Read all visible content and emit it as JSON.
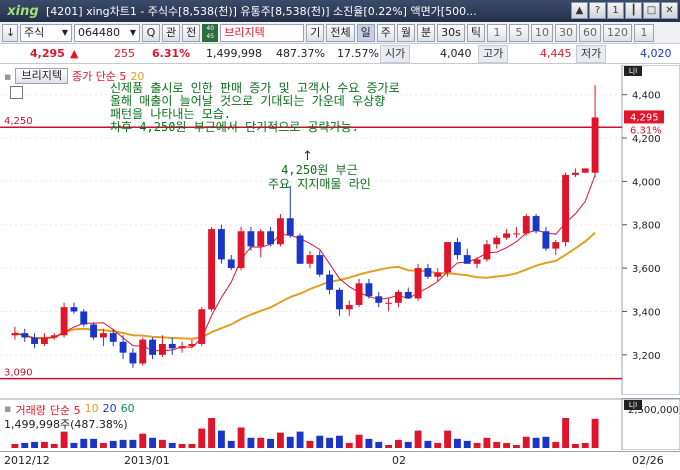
{
  "window": {
    "logo": "xing",
    "title": "[4201] xing차트1 - 주식수[8,538(천)] 유통주[8,538(천)] 소진율[0.22%] 액면가[500...",
    "buttons": [
      "▲",
      "?",
      "1",
      "┃",
      "□",
      "✕"
    ]
  },
  "toolbar": {
    "arrow": "↓",
    "market": "주식",
    "code": "064480",
    "search_label": "Q",
    "buttons_a": [
      "관",
      "전"
    ],
    "badge": "40\n45",
    "name": "브리지텍",
    "period_label": "기",
    "all_label": "전체",
    "periods": [
      "일",
      "주",
      "월",
      "분",
      "30s",
      "틱"
    ],
    "intervals": [
      "1",
      "5",
      "10",
      "30",
      "60",
      "120",
      "1"
    ]
  },
  "quote": {
    "price": "4,295",
    "change_arrow": "▲",
    "change": "255",
    "change_pct": "6.31%",
    "volume": "1,499,998",
    "vol_ratio": "487.37%",
    "turnover": "17.57%",
    "open_label": "시가",
    "open": "4,040",
    "high_label": "고가",
    "high": "4,445",
    "low_label": "저가",
    "low": "4,020"
  },
  "legend": {
    "indicator_button": "브리지텍",
    "ma_label": "종가 단순 5",
    "ma_period2": "20"
  },
  "annotation": {
    "main": "신제품 출시로 인한 판매 증가 및 고객사 수요 증가로\n올해 매출이 늘어날 것으로 기대되는 가운데 우상향\n패턴을 나타내는 모습.\n차후 4,250원 부근에서 단기적으로 공략가능.",
    "arrow": "↑",
    "support": "4,250원 부근\n주요 지지매물 라인"
  },
  "levels": {
    "upper_label": "4,250",
    "lower_label": "3,090",
    "current_price_tag": "4,295",
    "current_pct_tag": "6.31%"
  },
  "axis": {
    "price_ticks": [
      "4,400",
      "4,200",
      "4,000",
      "3,800",
      "3,600",
      "3,400",
      "3,200"
    ],
    "vol_tick": "2,500,000",
    "dates": [
      "2012/12",
      "2013/01",
      "02",
      "02/26"
    ]
  },
  "volume_panel": {
    "legend_label": "거래량",
    "ma_label": "단순 5",
    "periods": [
      "10",
      "20",
      "60"
    ],
    "value": "1,499,998주(487.38%)"
  },
  "colors": {
    "up": "#e0142a",
    "down": "#1a36c8",
    "ma5": "#e0142a",
    "ma20": "#e0a020",
    "annotation": "#0a6e1a"
  },
  "chart_data": {
    "type": "candlestick",
    "ylim": [
      3090,
      4500
    ],
    "candles": [
      [
        3290,
        3330,
        3270,
        3300
      ],
      [
        3300,
        3320,
        3260,
        3280
      ],
      [
        3280,
        3300,
        3230,
        3250
      ],
      [
        3250,
        3300,
        3240,
        3280
      ],
      [
        3280,
        3300,
        3270,
        3290
      ],
      [
        3290,
        3440,
        3280,
        3420
      ],
      [
        3420,
        3440,
        3390,
        3400
      ],
      [
        3400,
        3410,
        3330,
        3340
      ],
      [
        3340,
        3350,
        3270,
        3280
      ],
      [
        3280,
        3320,
        3240,
        3300
      ],
      [
        3300,
        3320,
        3240,
        3260
      ],
      [
        3260,
        3290,
        3180,
        3210
      ],
      [
        3210,
        3230,
        3140,
        3160
      ],
      [
        3160,
        3280,
        3150,
        3270
      ],
      [
        3270,
        3280,
        3180,
        3200
      ],
      [
        3200,
        3290,
        3190,
        3250
      ],
      [
        3250,
        3280,
        3200,
        3230
      ],
      [
        3230,
        3260,
        3210,
        3240
      ],
      [
        3240,
        3270,
        3230,
        3250
      ],
      [
        3250,
        3420,
        3240,
        3410
      ],
      [
        3410,
        3790,
        3400,
        3780
      ],
      [
        3780,
        3800,
        3620,
        3640
      ],
      [
        3640,
        3660,
        3590,
        3600
      ],
      [
        3600,
        3790,
        3590,
        3770
      ],
      [
        3770,
        3790,
        3680,
        3700
      ],
      [
        3700,
        3780,
        3650,
        3770
      ],
      [
        3770,
        3790,
        3700,
        3710
      ],
      [
        3710,
        3850,
        3700,
        3830
      ],
      [
        3830,
        3980,
        3740,
        3750
      ],
      [
        3750,
        3760,
        3620,
        3620
      ],
      [
        3620,
        3680,
        3600,
        3660
      ],
      [
        3660,
        3680,
        3560,
        3570
      ],
      [
        3570,
        3590,
        3480,
        3500
      ],
      [
        3500,
        3510,
        3380,
        3410
      ],
      [
        3410,
        3450,
        3380,
        3430
      ],
      [
        3430,
        3550,
        3420,
        3530
      ],
      [
        3530,
        3550,
        3460,
        3470
      ],
      [
        3470,
        3490,
        3420,
        3440
      ],
      [
        3440,
        3460,
        3400,
        3440
      ],
      [
        3440,
        3500,
        3420,
        3490
      ],
      [
        3490,
        3510,
        3460,
        3460
      ],
      [
        3460,
        3620,
        3450,
        3600
      ],
      [
        3600,
        3620,
        3550,
        3560
      ],
      [
        3560,
        3600,
        3540,
        3580
      ],
      [
        3580,
        3720,
        3560,
        3720
      ],
      [
        3720,
        3740,
        3640,
        3660
      ],
      [
        3660,
        3690,
        3620,
        3620
      ],
      [
        3620,
        3650,
        3600,
        3640
      ],
      [
        3640,
        3730,
        3630,
        3710
      ],
      [
        3710,
        3750,
        3690,
        3740
      ],
      [
        3740,
        3780,
        3730,
        3760
      ],
      [
        3760,
        3790,
        3740,
        3760
      ],
      [
        3760,
        3850,
        3750,
        3840
      ],
      [
        3840,
        3850,
        3760,
        3770
      ],
      [
        3770,
        3790,
        3680,
        3690
      ],
      [
        3690,
        3730,
        3660,
        3720
      ],
      [
        3720,
        4040,
        3700,
        4030
      ],
      [
        4030,
        4060,
        4020,
        4040
      ],
      [
        4040,
        4060,
        4040,
        4060
      ],
      [
        4040,
        4445,
        4020,
        4295
      ]
    ]
  }
}
